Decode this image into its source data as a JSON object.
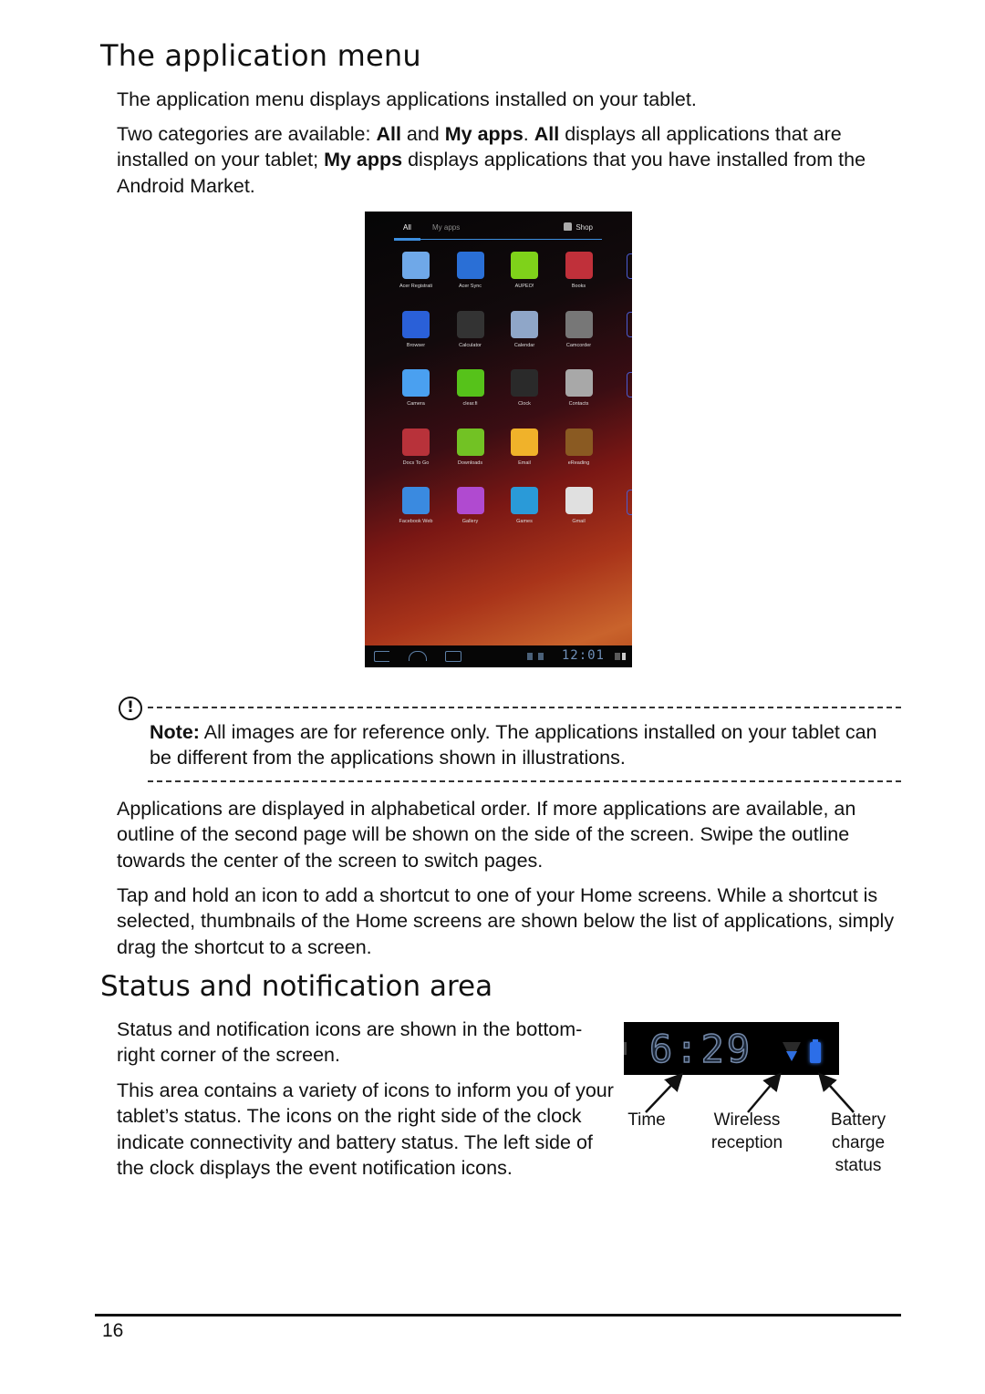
{
  "section1": {
    "heading": "The application menu",
    "p1": "The application menu displays applications installed on your tablet.",
    "p2_parts": {
      "a": "Two categories are available: ",
      "b": "All",
      "c": " and ",
      "d": "My apps",
      "e": ". ",
      "f": "All",
      "g": " displays all applications that are installed on your tablet; ",
      "h": "My apps",
      "i": " displays applications that you have installed from the Android Market."
    }
  },
  "screenshot": {
    "tabs": [
      {
        "label": "All",
        "active": true
      },
      {
        "label": "My apps",
        "active": false
      }
    ],
    "shop_label": "Shop",
    "apps": [
      {
        "label": "Acer Registrati",
        "icon": "clipboard-icon",
        "color": "#6fa8e8"
      },
      {
        "label": "Acer Sync",
        "icon": "sync-icon",
        "color": "#2a6fd6"
      },
      {
        "label": "AUPEO!",
        "icon": "aupeo-icon",
        "color": "#7fd21a"
      },
      {
        "label": "Books",
        "icon": "books-icon",
        "color": "#c0303a"
      },
      {
        "label": "Browser",
        "icon": "globe-icon",
        "color": "#2a60d8"
      },
      {
        "label": "Calculator",
        "icon": "calculator-icon",
        "color": "#333333"
      },
      {
        "label": "Calendar",
        "icon": "calendar-icon",
        "color": "#8fa6c8"
      },
      {
        "label": "Camcorder",
        "icon": "camcorder-icon",
        "color": "#777777"
      },
      {
        "label": "Camera",
        "icon": "camera-icon",
        "color": "#4aa0f0"
      },
      {
        "label": "clear.fi",
        "icon": "clearfi-icon",
        "color": "#56c21a"
      },
      {
        "label": "Clock",
        "icon": "clock-icon",
        "color": "#2a2a2a"
      },
      {
        "label": "Contacts",
        "icon": "contacts-icon",
        "color": "#a8a8a8"
      },
      {
        "label": "Docs To Go",
        "icon": "docs-icon",
        "color": "#b8323a"
      },
      {
        "label": "Downloads",
        "icon": "download-icon",
        "color": "#72c224"
      },
      {
        "label": "Email",
        "icon": "email-icon",
        "color": "#f0b22a"
      },
      {
        "label": "eReading",
        "icon": "bookshelf-icon",
        "color": "#8a5a22"
      },
      {
        "label": "Facebook Web",
        "icon": "facebook-icon",
        "color": "#3a8ae0"
      },
      {
        "label": "Gallery",
        "icon": "gallery-icon",
        "color": "#b04ad0"
      },
      {
        "label": "Games",
        "icon": "games-icon",
        "color": "#2a9ad8"
      },
      {
        "label": "Gmail",
        "icon": "gmail-icon",
        "color": "#e0e0e0"
      }
    ],
    "clock": "12:01"
  },
  "note": {
    "label": "Note:",
    "text": " All images are for reference only. The applications installed on your tablet can be different from the applications shown in illustrations."
  },
  "section1_more": {
    "p3": "Applications are displayed in alphabetical order. If more applications are available, an outline of the second page will be shown on the side of the screen. Swipe the outline towards the center of the screen to switch pages.",
    "p4": "Tap and hold an icon to add a shortcut to one of your Home screens. While a shortcut is selected, thumbnails of the Home screens are shown below the list of applications, simply drag the shortcut to a screen."
  },
  "section2": {
    "heading": "Status and notification area",
    "p1": "Status and notification icons are shown in the bottom-right corner of the screen.",
    "p2": "This area contains a variety of icons to inform you of your tablet’s status. The icons on the right side of the clock indicate connectivity and battery status. The left side of the clock displays the event notification icons.",
    "status_clock": "6:29",
    "labels": {
      "time": "Time",
      "wireless": "Wireless\nreception",
      "battery": "Battery\ncharge\nstatus"
    }
  },
  "footer": {
    "page_number": "16"
  }
}
